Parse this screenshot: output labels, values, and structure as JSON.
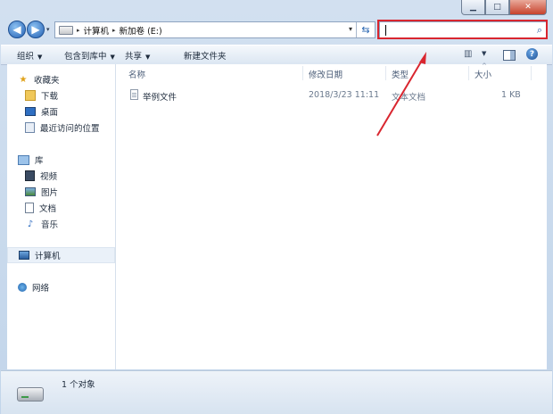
{
  "window": {
    "controls": {
      "minimize": "▁",
      "maximize": "□",
      "close": "✕"
    }
  },
  "nav": {
    "back_icon": "back-arrow-icon",
    "forward_icon": "forward-arrow-icon",
    "history_dropdown": "▾"
  },
  "address": {
    "separator": "▸",
    "crumbs": [
      "计算机",
      "新加卷 (E:)"
    ],
    "dropdown": "▾",
    "refresh_glyph": "⇆"
  },
  "search": {
    "value": "",
    "icon": "search-icon",
    "highlight_color": "#d9262f"
  },
  "toolbar": {
    "organize": "组织",
    "include_in_library": "包含到库中",
    "share": "共享",
    "new_folder": "新建文件夹",
    "dropdown_arrow": "▼",
    "view_icon": "view-options-icon",
    "view_glyph": "▥",
    "help_glyph": "?"
  },
  "sidebar": {
    "favorites": {
      "label": "收藏夹",
      "items": [
        {
          "label": "下载",
          "icon": "download-folder-icon"
        },
        {
          "label": "桌面",
          "icon": "desktop-icon"
        },
        {
          "label": "最近访问的位置",
          "icon": "recent-places-icon"
        }
      ]
    },
    "libraries": {
      "label": "库",
      "items": [
        {
          "label": "视频",
          "icon": "video-library-icon"
        },
        {
          "label": "图片",
          "icon": "pictures-library-icon"
        },
        {
          "label": "文档",
          "icon": "documents-library-icon"
        },
        {
          "label": "音乐",
          "icon": "music-library-icon"
        }
      ]
    },
    "computer": {
      "label": "计算机",
      "icon": "computer-icon"
    },
    "network": {
      "label": "网络",
      "icon": "network-icon"
    }
  },
  "columns": {
    "name": "名称",
    "modified": "修改日期",
    "type": "类型",
    "size": "大小"
  },
  "files": [
    {
      "name": "举例文件",
      "modified": "2018/3/23 11:11",
      "type": "文本文档",
      "size": "1 KB"
    }
  ],
  "status": {
    "item_count": "1 个对象"
  },
  "annotation": {
    "color": "#d9262f"
  }
}
